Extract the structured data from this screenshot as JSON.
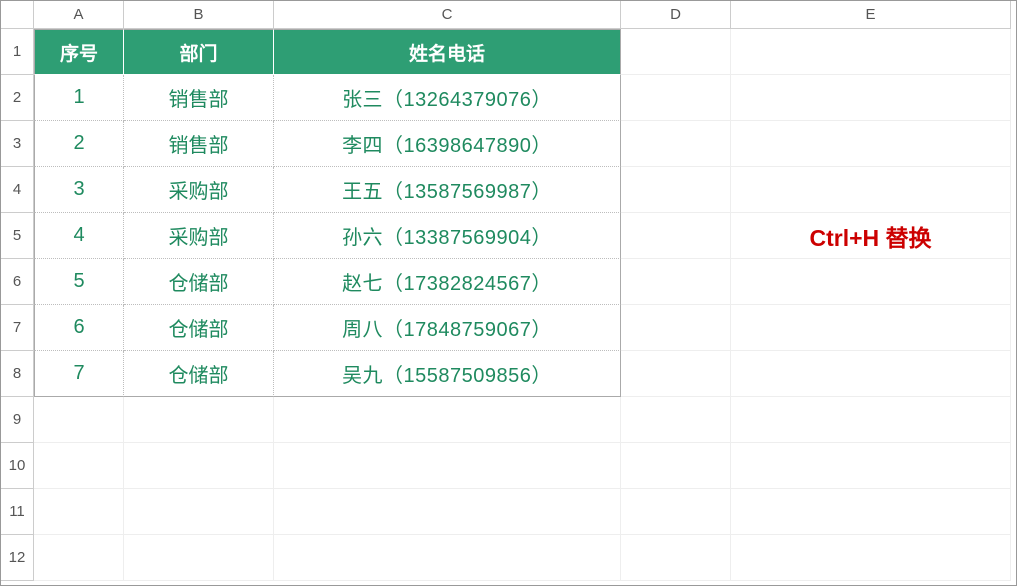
{
  "columns": [
    "A",
    "B",
    "C",
    "D",
    "E"
  ],
  "row_count": 12,
  "table": {
    "headers": {
      "a": "序号",
      "b": "部门",
      "c": "姓名电话"
    },
    "rows": [
      {
        "a": "1",
        "b": "销售部",
        "c": "张三（13264379076）"
      },
      {
        "a": "2",
        "b": "销售部",
        "c": "李四（16398647890）"
      },
      {
        "a": "3",
        "b": "采购部",
        "c": "王五（13587569987）"
      },
      {
        "a": "4",
        "b": "采购部",
        "c": "孙六（13387569904）"
      },
      {
        "a": "5",
        "b": "仓储部",
        "c": "赵七（17382824567）"
      },
      {
        "a": "6",
        "b": "仓储部",
        "c": "周八（17848759067）"
      },
      {
        "a": "7",
        "b": "仓储部",
        "c": "吴九（15587509856）"
      }
    ]
  },
  "annotation": {
    "text": "Ctrl+H 替换"
  },
  "colors": {
    "header_bg": "#2e9e74",
    "data_fg": "#1f8a5f",
    "annot_fg": "#cc0000"
  }
}
